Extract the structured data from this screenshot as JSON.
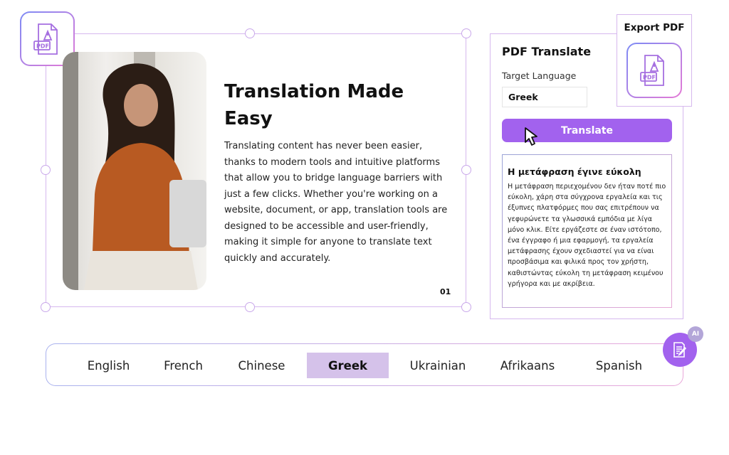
{
  "slide": {
    "title": "Translation Made Easy",
    "body": "Translating content has never been easier, thanks to modern tools and intuitive platforms that allow you to bridge language barriers with just a few clicks. Whether you're working on a website, document, or app, translation tools are designed to be accessible and user-friendly, making it simple for anyone to translate text quickly and accurately.",
    "page_number": "01",
    "pdf_icon_label": "PDF"
  },
  "panel": {
    "title": "PDF Translate",
    "target_label": "Target Language",
    "target_value": "Greek",
    "translate_label": "Translate",
    "result_title": "Η μετάφραση έγινε εύκολη",
    "result_body": "Η μετάφραση περιεχομένου δεν ήταν ποτέ πιο εύκολη, χάρη στα σύγχρονα εργαλεία και τις έξυπνες πλατφόρμες που σας επιτρέπουν να γεφυρώνετε τα γλωσσικά εμπόδια με λίγα μόνο κλικ. Είτε εργάζεστε σε έναν ιστότοπο, ένα έγγραφο ή μια εφαρμογή, τα εργαλεία μετάφρασης έχουν σχεδιαστεί για να είναι προσβάσιμα και φιλικά προς τον χρήστη, καθιστώντας εύκολη τη μετάφραση κειμένου γρήγορα και με ακρίβεια."
  },
  "export": {
    "label": "Export PDF",
    "icon_label": "PDF"
  },
  "languages": [
    {
      "label": "English",
      "selected": false
    },
    {
      "label": "French",
      "selected": false
    },
    {
      "label": "Chinese",
      "selected": false
    },
    {
      "label": "Greek",
      "selected": true
    },
    {
      "label": "Ukrainian",
      "selected": false
    },
    {
      "label": "Afrikaans",
      "selected": false
    },
    {
      "label": "Spanish",
      "selected": false
    }
  ],
  "ai_badge": "AI",
  "colors": {
    "accent": "#a262ee",
    "selected_lang": "#d5c2ea",
    "frame": "#d6b8ee"
  }
}
